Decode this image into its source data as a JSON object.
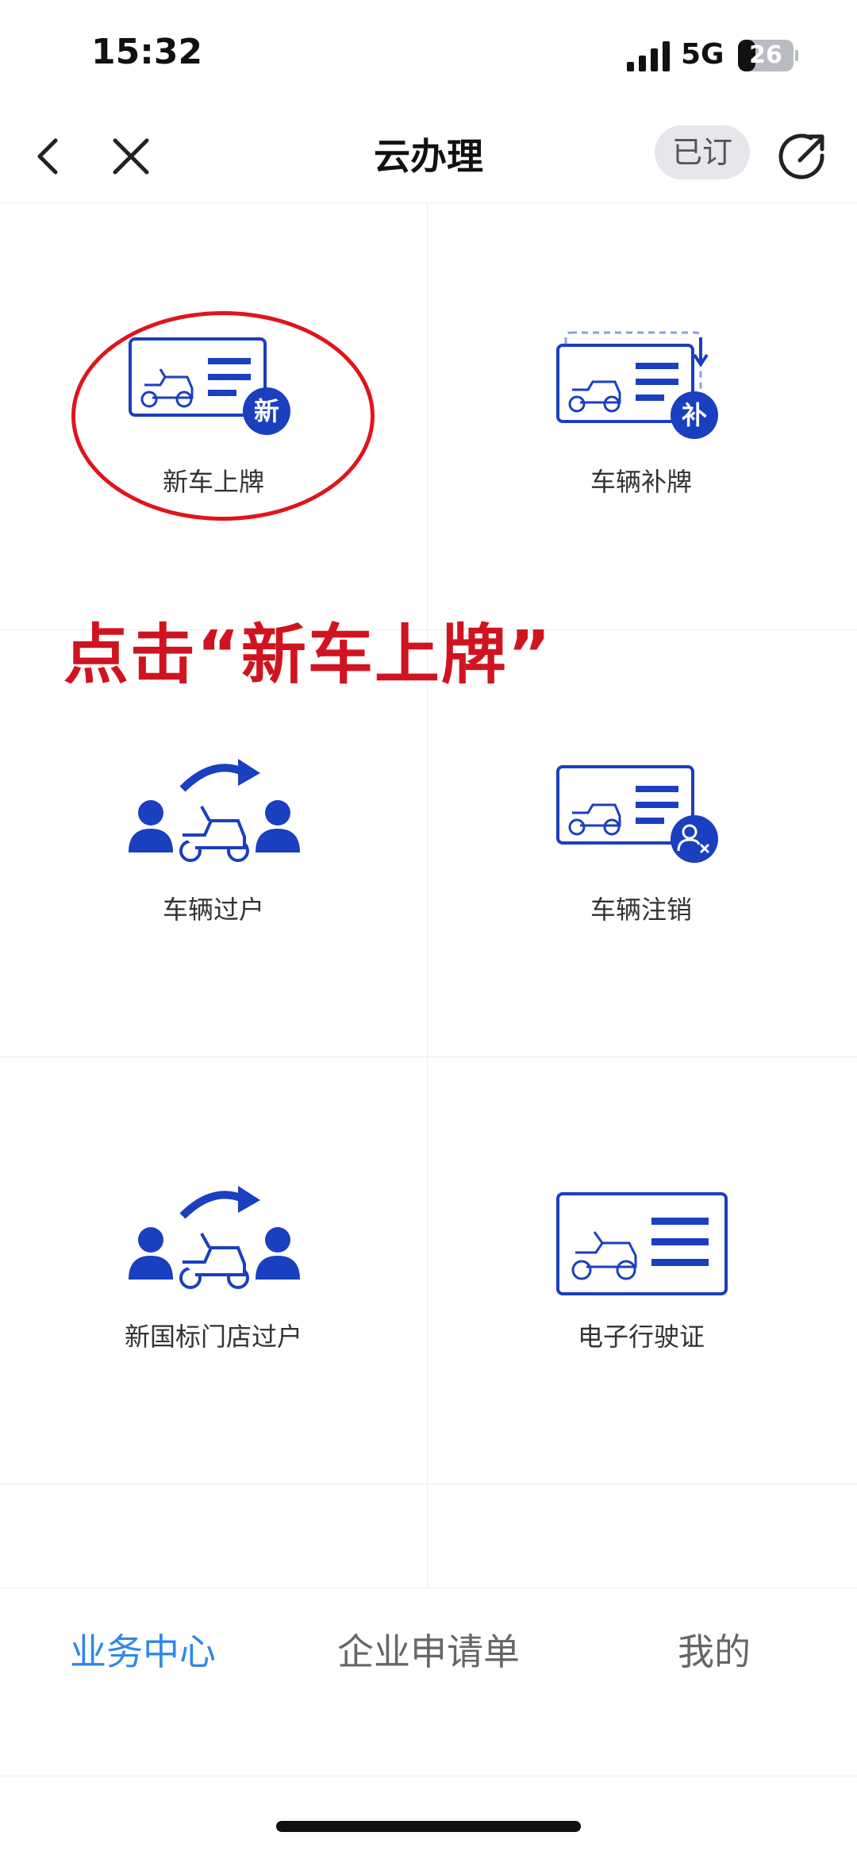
{
  "status": {
    "time": "15:32",
    "network": "5G",
    "battery": "26"
  },
  "nav": {
    "title": "云办理",
    "subscribe": "已订"
  },
  "tiles": [
    {
      "label": "新车上牌",
      "badge": "新"
    },
    {
      "label": "车辆补牌",
      "badge": "补"
    },
    {
      "label": "车辆过户"
    },
    {
      "label": "车辆注销"
    },
    {
      "label": "新国标门店过户"
    },
    {
      "label": "电子行驶证"
    }
  ],
  "annotation": {
    "hint": "点击“新车上牌”"
  },
  "tabs": [
    {
      "label": "业务中心",
      "active": true
    },
    {
      "label": "企业申请单",
      "active": false
    },
    {
      "label": "我的",
      "active": false
    }
  ],
  "colors": {
    "brand": "#1a3fbf",
    "annotation": "#d0141f",
    "tab_active": "#2f88e6"
  }
}
